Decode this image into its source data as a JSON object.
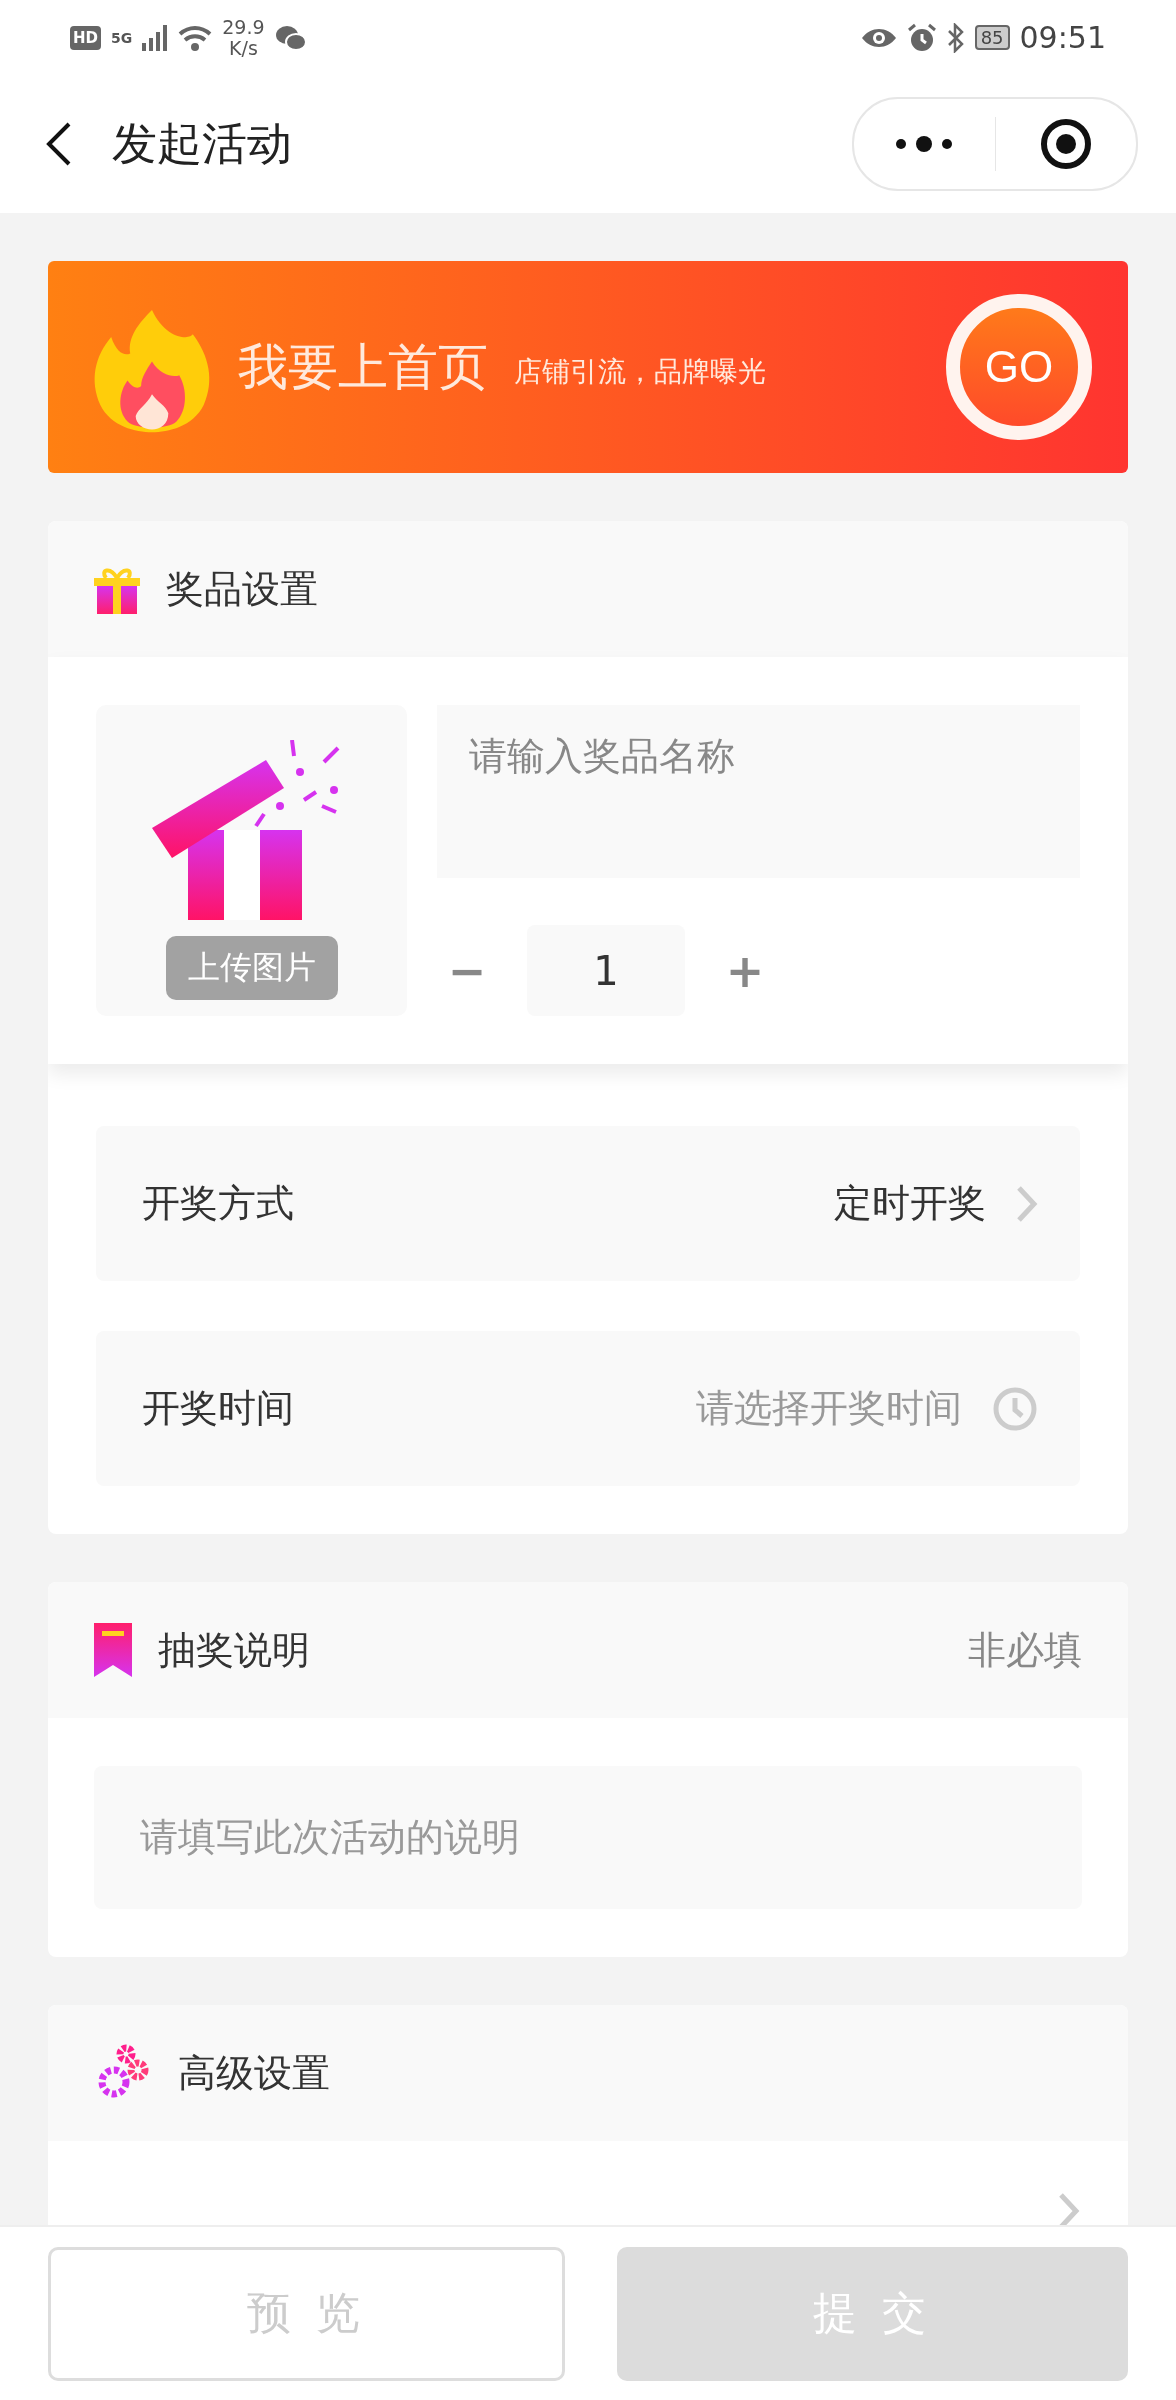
{
  "status_bar": {
    "hd": "HD",
    "network": "5G",
    "speed": "29.9",
    "speed_unit": "K/s",
    "battery": "85",
    "time": "09:51"
  },
  "nav": {
    "title": "发起活动"
  },
  "banner": {
    "title": "我要上首页",
    "subtitle": "店铺引流，品牌曝光",
    "button": "GO"
  },
  "prize_section": {
    "title": "奖品设置",
    "upload_label": "上传图片",
    "name_placeholder": "请输入奖品名称",
    "minus": "−",
    "quantity": "1",
    "plus": "+",
    "rows": [
      {
        "kind": "select",
        "label": "开奖方式",
        "value": "定时开奖"
      },
      {
        "kind": "time",
        "label": "开奖时间",
        "placeholder": "请选择开奖时间"
      }
    ]
  },
  "description_section": {
    "title": "抽奖说明",
    "note": "非必填",
    "placeholder": "请填写此次活动的说明"
  },
  "advanced_section": {
    "title": "高级设置"
  },
  "footer": {
    "buttons": [
      {
        "kind": "outline",
        "label": "预 览"
      },
      {
        "kind": "filled",
        "label": "提 交"
      }
    ]
  }
}
